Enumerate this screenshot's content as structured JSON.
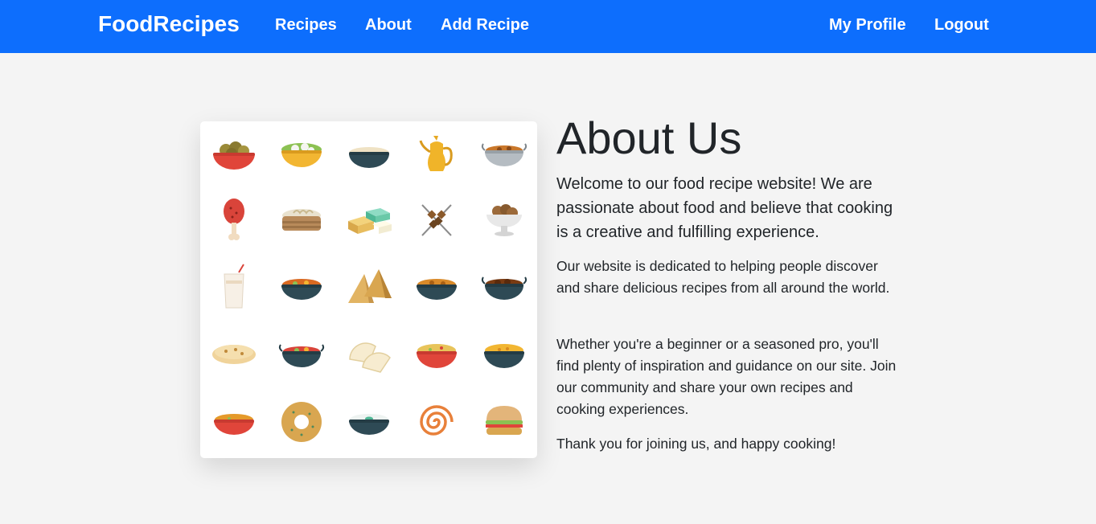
{
  "navbar": {
    "brand": "FoodRecipes",
    "links": [
      "Recipes",
      "About",
      "Add Recipe"
    ],
    "right_links": [
      "My Profile",
      "Logout"
    ],
    "color": "#0d6efd"
  },
  "about": {
    "title": "About Us",
    "lead": "Welcome to our food recipe website! We are passionate about food and believe that cooking is a creative and fulfilling experience.",
    "paragraphs": [
      "Our website is dedicated to helping people discover and share delicious recipes from all around the world.",
      "Whether you're a beginner or a seasoned pro, you'll find plenty of inspiration and guidance on our site. Join our community and share your own recipes and cooking experiences.",
      "Thank you for joining us, and happy cooking!"
    ]
  },
  "food_icons": [
    "bowl-meatballs-icon",
    "bowl-dumplings-icon",
    "bowl-porridge-icon",
    "teapot-icon",
    "pot-curry-icon",
    "chicken-leg-icon",
    "steamer-basket-icon",
    "paneer-cubes-icon",
    "skewers-icon",
    "sweets-bowl-icon",
    "lassi-glass-icon",
    "bowl-stew-icon",
    "samosa-icon",
    "bowl-lentils-icon",
    "pot-kofta-icon",
    "naan-bread-icon",
    "pot-tomato-curry-icon",
    "gujiya-icon",
    "bowl-biryani-icon",
    "bowl-rice-icon",
    "bowl-dal-icon",
    "donut-icon",
    "bowl-raita-icon",
    "jalebi-icon",
    "burger-icon"
  ]
}
